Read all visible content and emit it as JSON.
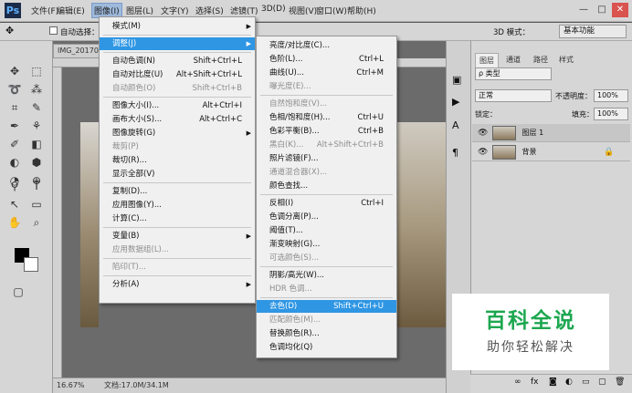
{
  "app": {
    "logo": "Ps"
  },
  "menubar": [
    "文件(F)",
    "编辑(E)",
    "图像(I)",
    "图层(L)",
    "文字(Y)",
    "选择(S)",
    "滤镜(T)",
    "3D(D)",
    "视图(V)",
    "窗口(W)",
    "帮助(H)"
  ],
  "active_menu": "图像(I)",
  "window_controls": {
    "minimize": "—",
    "maximize": "□",
    "close": "✕"
  },
  "options_bar": {
    "auto_select": "自动选择：",
    "mode_3d": "3D 模式：",
    "workspace": "基本功能"
  },
  "document": {
    "tab": "IMG_201704",
    "zoom": "16.67%",
    "doc_info": "文档:17.0M/34.1M"
  },
  "image_menu": [
    {
      "label": "模式(M)",
      "sc": "",
      "arrow": true,
      "dis": false
    },
    {
      "sep": true
    },
    {
      "label": "调整(J)",
      "sc": "",
      "arrow": true,
      "dis": false,
      "hl": true
    },
    {
      "sep": true
    },
    {
      "label": "自动色调(N)",
      "sc": "Shift+Ctrl+L",
      "dis": false
    },
    {
      "label": "自动对比度(U)",
      "sc": "Alt+Shift+Ctrl+L",
      "dis": false
    },
    {
      "label": "自动颜色(O)",
      "sc": "Shift+Ctrl+B",
      "dis": true
    },
    {
      "sep": true
    },
    {
      "label": "图像大小(I)...",
      "sc": "Alt+Ctrl+I",
      "dis": false
    },
    {
      "label": "画布大小(S)...",
      "sc": "Alt+Ctrl+C",
      "dis": false
    },
    {
      "label": "图像旋转(G)",
      "sc": "",
      "arrow": true,
      "dis": false
    },
    {
      "label": "裁剪(P)",
      "sc": "",
      "dis": true
    },
    {
      "label": "裁切(R)...",
      "sc": "",
      "dis": false
    },
    {
      "label": "显示全部(V)",
      "sc": "",
      "dis": false
    },
    {
      "sep": true
    },
    {
      "label": "复制(D)...",
      "sc": "",
      "dis": false
    },
    {
      "label": "应用图像(Y)...",
      "sc": "",
      "dis": false
    },
    {
      "label": "计算(C)...",
      "sc": "",
      "dis": false
    },
    {
      "sep": true
    },
    {
      "label": "变量(B)",
      "sc": "",
      "arrow": true,
      "dis": false
    },
    {
      "label": "应用数据组(L)...",
      "sc": "",
      "dis": true
    },
    {
      "sep": true
    },
    {
      "label": "陷印(T)...",
      "sc": "",
      "dis": true
    },
    {
      "sep": true
    },
    {
      "label": "分析(A)",
      "sc": "",
      "arrow": true,
      "dis": false
    }
  ],
  "adjust_menu": [
    {
      "label": "亮度/对比度(C)...",
      "sc": "",
      "dis": false
    },
    {
      "label": "色阶(L)...",
      "sc": "Ctrl+L",
      "dis": false
    },
    {
      "label": "曲线(U)...",
      "sc": "Ctrl+M",
      "dis": false
    },
    {
      "label": "曝光度(E)...",
      "sc": "",
      "dis": true
    },
    {
      "sep": true
    },
    {
      "label": "自然饱和度(V)...",
      "sc": "",
      "dis": true
    },
    {
      "label": "色相/饱和度(H)...",
      "sc": "Ctrl+U",
      "dis": false
    },
    {
      "label": "色彩平衡(B)...",
      "sc": "Ctrl+B",
      "dis": false
    },
    {
      "label": "黑白(K)...",
      "sc": "Alt+Shift+Ctrl+B",
      "dis": true
    },
    {
      "label": "照片滤镜(F)...",
      "sc": "",
      "dis": false
    },
    {
      "label": "通道混合器(X)...",
      "sc": "",
      "dis": true
    },
    {
      "label": "颜色查找...",
      "sc": "",
      "dis": false
    },
    {
      "sep": true
    },
    {
      "label": "反相(I)",
      "sc": "Ctrl+I",
      "dis": false
    },
    {
      "label": "色调分离(P)...",
      "sc": "",
      "dis": false
    },
    {
      "label": "阈值(T)...",
      "sc": "",
      "dis": false
    },
    {
      "label": "渐变映射(G)...",
      "sc": "",
      "dis": false
    },
    {
      "label": "可选颜色(S)...",
      "sc": "",
      "dis": true
    },
    {
      "sep": true
    },
    {
      "label": "阴影/高光(W)...",
      "sc": "",
      "dis": false
    },
    {
      "label": "HDR 色调...",
      "sc": "",
      "dis": true
    },
    {
      "sep": true
    },
    {
      "label": "去色(D)",
      "sc": "Shift+Ctrl+U",
      "dis": false,
      "hl": true
    },
    {
      "label": "匹配颜色(M)...",
      "sc": "",
      "dis": true
    },
    {
      "label": "替换颜色(R)...",
      "sc": "",
      "dis": false
    },
    {
      "label": "色调均化(Q)",
      "sc": "",
      "dis": false
    }
  ],
  "layers_panel": {
    "tabs": [
      "图层",
      "通道",
      "路径",
      "样式"
    ],
    "filter": "ρ 类型",
    "blend_mode": "正常",
    "opacity_label": "不透明度：",
    "opacity_value": "100%",
    "lock_label": "锁定：",
    "fill_label": "填充：",
    "fill_value": "100%",
    "layers": [
      "图层 1",
      "背景"
    ]
  },
  "watermark": {
    "title": "百科全说",
    "subtitle": "助你轻松解决"
  },
  "colors": {
    "highlight": "#2f96e4",
    "watermark_green": "#1da750"
  }
}
